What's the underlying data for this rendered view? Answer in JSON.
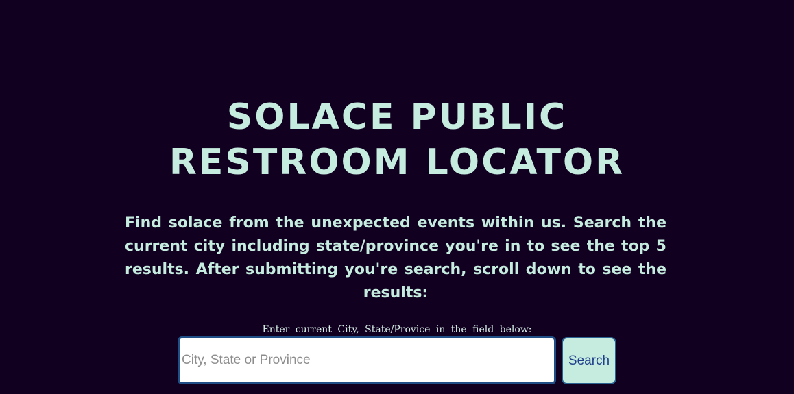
{
  "header": {
    "title_line1": "Solace Public",
    "title_line2": "Restroom Locator"
  },
  "intro": {
    "description": "Find solace from the unexpected events within us. Search the current city including state/province you're in to see the top 5 results. After submitting you're search, scroll down to see the results:"
  },
  "search": {
    "label": "Enter current City, State/Provice in the field below:",
    "placeholder": "City, State or Province",
    "value": "",
    "button_label": "Search"
  },
  "colors": {
    "background": "#110020",
    "accent": "#c5ecdf",
    "button_text": "#1f3f8a",
    "input_border": "#1f4f86"
  }
}
